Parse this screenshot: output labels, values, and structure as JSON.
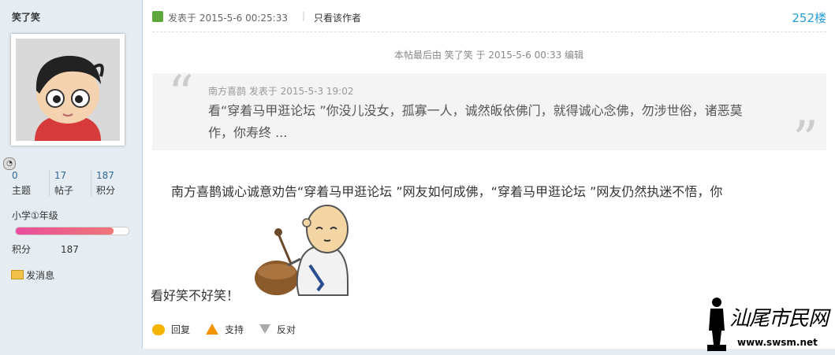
{
  "author": {
    "name": "笑了笑",
    "stats": [
      {
        "num": "0",
        "label": "主题"
      },
      {
        "num": "17",
        "label": "帖子"
      },
      {
        "num": "187",
        "label": "积分"
      }
    ],
    "level": "小学①年级",
    "level_progress": 0.87,
    "credit_label": "积分",
    "credit_value": "187",
    "message_link": "发消息"
  },
  "post": {
    "posted_time": "发表于 2015-5-6 00:25:33",
    "separator": "|",
    "only_author": "只看该作者",
    "floor": "252楼",
    "edited_note": "本帖最后由 笑了笑 于 2015-5-6 00:33 编辑",
    "quote": {
      "meta": "南方喜鹊 发表于 2015-5-3 19:02",
      "text": "看“穿着马甲逛论坛 ”你没儿没女，孤寡一人，诚然皈依佛门，就得诚心念佛，勿涉世俗，诸恶莫作，你寿终 ..."
    },
    "body_line1": "南方喜鹊诚心诚意劝告“穿着马甲逛论坛 ”网友如何成佛，“穿着马甲逛论坛 ”网友仍然执迷不悟，你",
    "body_line2": "看好笑不好笑！"
  },
  "actions": {
    "reply": "回复",
    "support": "支持",
    "oppose": "反对"
  },
  "watermark": {
    "title": "汕尾市民网",
    "url": "www.swsm.net"
  },
  "icons": [
    "avatar-image",
    "online-status-icon",
    "message-icon",
    "post-time-icon",
    "reply-icon",
    "support-icon",
    "oppose-icon",
    "monk-emoticon"
  ],
  "colors": {
    "sidebar_bg": "#e5edf2",
    "floor_link": "#2b9fd8",
    "level_bar": "#e84d9e"
  }
}
